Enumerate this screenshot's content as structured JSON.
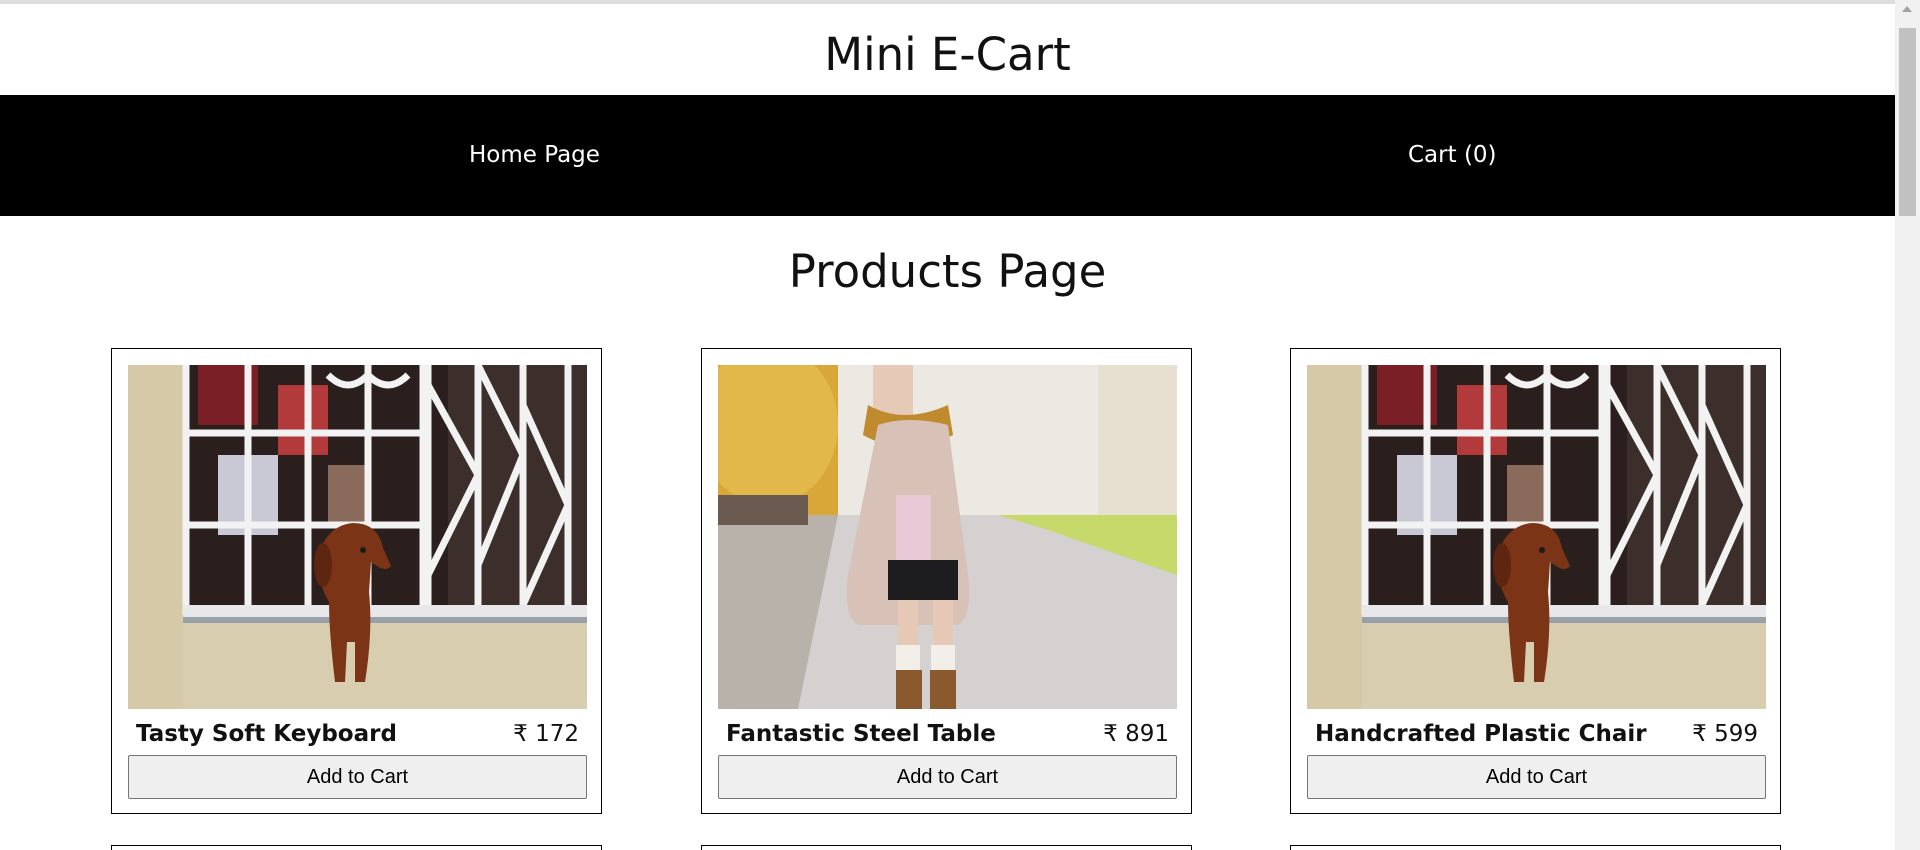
{
  "site": {
    "title": "Mini E-Cart"
  },
  "nav": {
    "home_label": "Home Page",
    "cart_label": "Cart (0)"
  },
  "page": {
    "heading": "Products Page"
  },
  "products": [
    {
      "name": "Tasty Soft Keyboard",
      "price": "₹ 172",
      "button_label": "Add to Cart",
      "image": "dog-at-window-photo"
    },
    {
      "name": "Fantastic Steel Table",
      "price": "₹ 891",
      "button_label": "Add to Cart",
      "image": "woman-in-coat-photo"
    },
    {
      "name": "Handcrafted Plastic Chair",
      "price": "₹ 599",
      "button_label": "Add to Cart",
      "image": "dog-at-window-photo"
    }
  ],
  "colors": {
    "navbar_bg": "#000000",
    "nav_text": "#ffffff",
    "button_bg": "#efefef",
    "card_border": "#000000"
  }
}
